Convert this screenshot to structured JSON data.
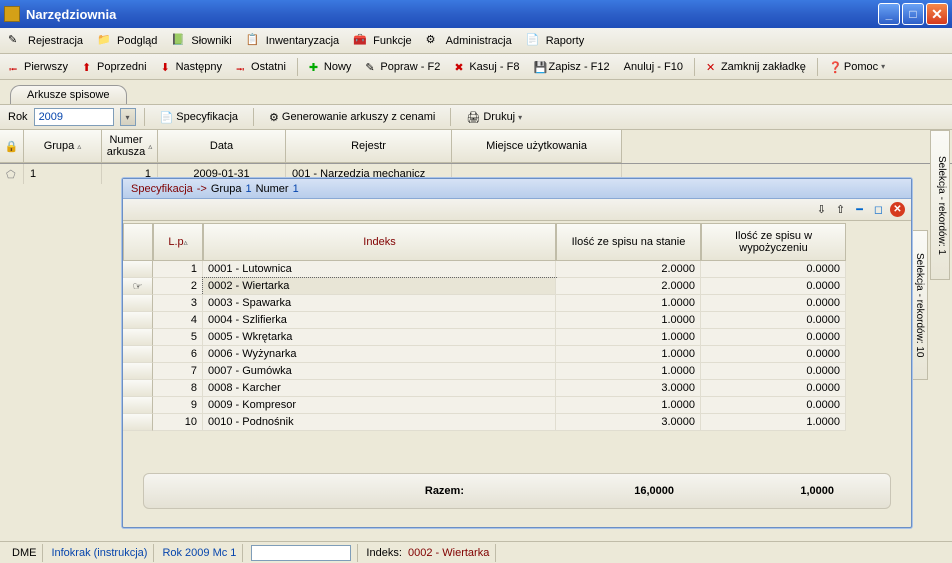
{
  "title": "Narzędziownia",
  "menu": {
    "rejestracja": "Rejestracja",
    "podglad": "Podgląd",
    "slowniki": "Słowniki",
    "inwentaryzacja": "Inwentaryzacja",
    "funkcje": "Funkcje",
    "administracja": "Administracja",
    "raporty": "Raporty"
  },
  "toolbar": {
    "pierwszy": "Pierwszy",
    "poprzedni": "Poprzedni",
    "nastepny": "Następny",
    "ostatni": "Ostatni",
    "nowy": "Nowy",
    "popraw": "Popraw - F2",
    "kasuj": "Kasuj - F8",
    "zapisz": "Zapisz - F12",
    "anuluj": "Anuluj - F10",
    "zamknij": "Zamknij zakładkę",
    "pomoc": "Pomoc"
  },
  "tab": "Arkusze spisowe",
  "rokbar": {
    "rok_label": "Rok",
    "rok_value": "2009",
    "spec": "Specyfikacja",
    "gen": "Generowanie arkuszy z cenami",
    "drukuj": "Drukuj"
  },
  "grid": {
    "grupa": "Grupa",
    "numer": "Numer arkusza",
    "data": "Data",
    "rejestr": "Rejestr",
    "miejsce": "Miejsce użytkowania",
    "row": {
      "grupa": "1",
      "numer": "1",
      "data": "2009-01-31",
      "rejestr": "001 - Narzędzia mechanicz"
    }
  },
  "subwin": {
    "spec": "Specyfikacja",
    "arrow": "->",
    "grupa_l": "Grupa",
    "grupa_v": "1",
    "numer_l": "Numer",
    "numer_v": "1",
    "headers": {
      "lp": "L.p",
      "indeks": "Indeks",
      "stan": "Ilość ze spisu na stanie",
      "wyp": "Ilość ze spisu w wypożyczeniu"
    },
    "rows": [
      {
        "lp": "1",
        "indeks": "0001 - Lutownica",
        "stan": "2.0000",
        "wyp": "0.0000"
      },
      {
        "lp": "2",
        "indeks": "0002 - Wiertarka",
        "stan": "2.0000",
        "wyp": "0.0000"
      },
      {
        "lp": "3",
        "indeks": "0003 - Spawarka",
        "stan": "1.0000",
        "wyp": "0.0000"
      },
      {
        "lp": "4",
        "indeks": "0004 - Szlifierka",
        "stan": "1.0000",
        "wyp": "0.0000"
      },
      {
        "lp": "5",
        "indeks": "0005 - Wkrętarka",
        "stan": "1.0000",
        "wyp": "0.0000"
      },
      {
        "lp": "6",
        "indeks": "0006 - Wyżynarka",
        "stan": "1.0000",
        "wyp": "0.0000"
      },
      {
        "lp": "7",
        "indeks": "0007 - Gumówka",
        "stan": "1.0000",
        "wyp": "0.0000"
      },
      {
        "lp": "8",
        "indeks": "0008 - Karcher",
        "stan": "3.0000",
        "wyp": "0.0000"
      },
      {
        "lp": "9",
        "indeks": "0009 - Kompresor",
        "stan": "1.0000",
        "wyp": "0.0000"
      },
      {
        "lp": "10",
        "indeks": "0010 - Podnośnik",
        "stan": "3.0000",
        "wyp": "1.0000"
      }
    ],
    "totals": {
      "label": "Razem:",
      "stan": "16,0000",
      "wyp": "1,0000"
    }
  },
  "side": {
    "tab1": "Selekcja - rekordów: 1",
    "tab2": "Selekcja - rekordów: 10"
  },
  "status": {
    "dme": "DME",
    "infokrak": "Infokrak (instrukcja)",
    "rok": "Rok 2009  Mc 1",
    "indeks_l": "Indeks:",
    "indeks_v": "0002 - Wiertarka"
  }
}
